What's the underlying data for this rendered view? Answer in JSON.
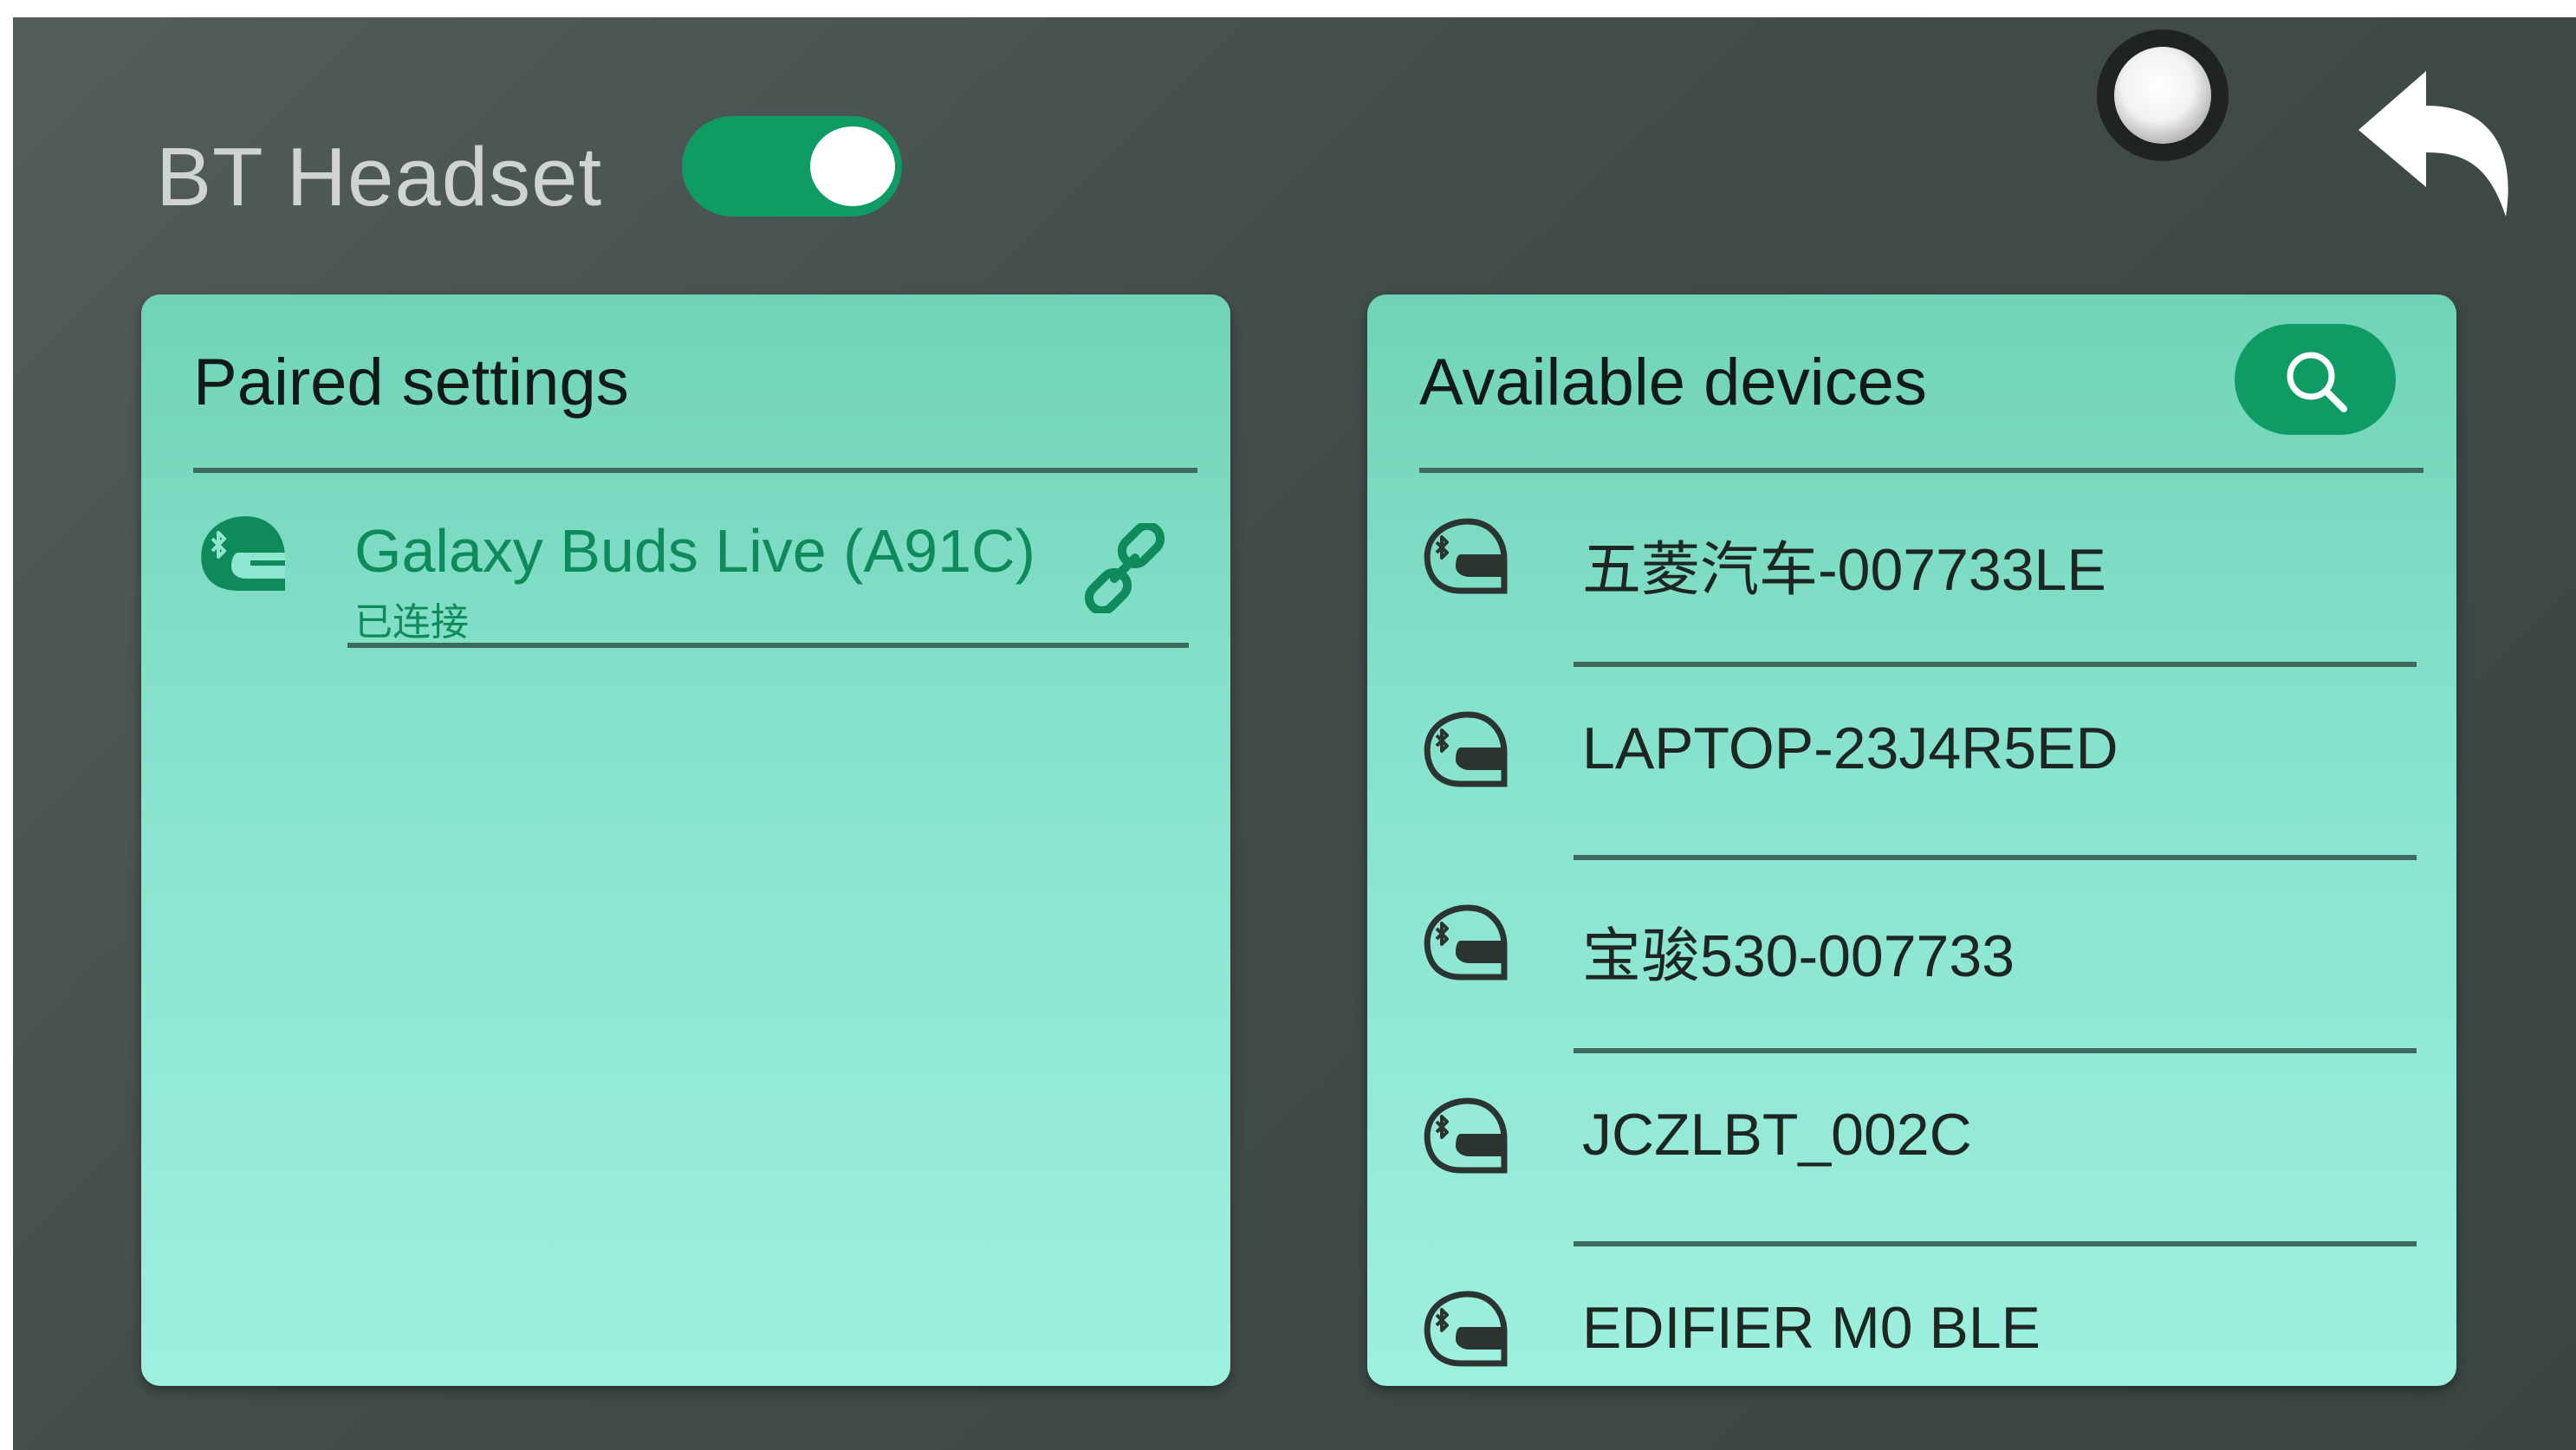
{
  "header": {
    "title": "BT Headset",
    "toggle_on": true,
    "toggle_color": "#0f9b64"
  },
  "paired": {
    "title": "Paired settings",
    "devices": [
      {
        "name": "Galaxy Buds Live (A91C)",
        "status": "已连接",
        "icon": "helmet-bluetooth-icon",
        "action_icon": "link-icon"
      }
    ]
  },
  "available": {
    "title": "Available devices",
    "search_icon": "search-icon",
    "devices": [
      {
        "name": "五菱汽车-007733LE",
        "icon": "helmet-bluetooth-icon"
      },
      {
        "name": "LAPTOP-23J4R5ED",
        "icon": "helmet-bluetooth-icon"
      },
      {
        "name": "宝骏530-007733",
        "icon": "helmet-bluetooth-icon"
      },
      {
        "name": "JCZLBT_002C",
        "icon": "helmet-bluetooth-icon"
      },
      {
        "name": "EDIFIER M0 BLE",
        "icon": "helmet-bluetooth-icon"
      }
    ]
  },
  "colors": {
    "accent": "#0f9b64",
    "paired_text": "#0f8a5a",
    "panel_top": "#70d3b7",
    "panel_bottom": "#9ef0de",
    "background": "#414b48"
  }
}
